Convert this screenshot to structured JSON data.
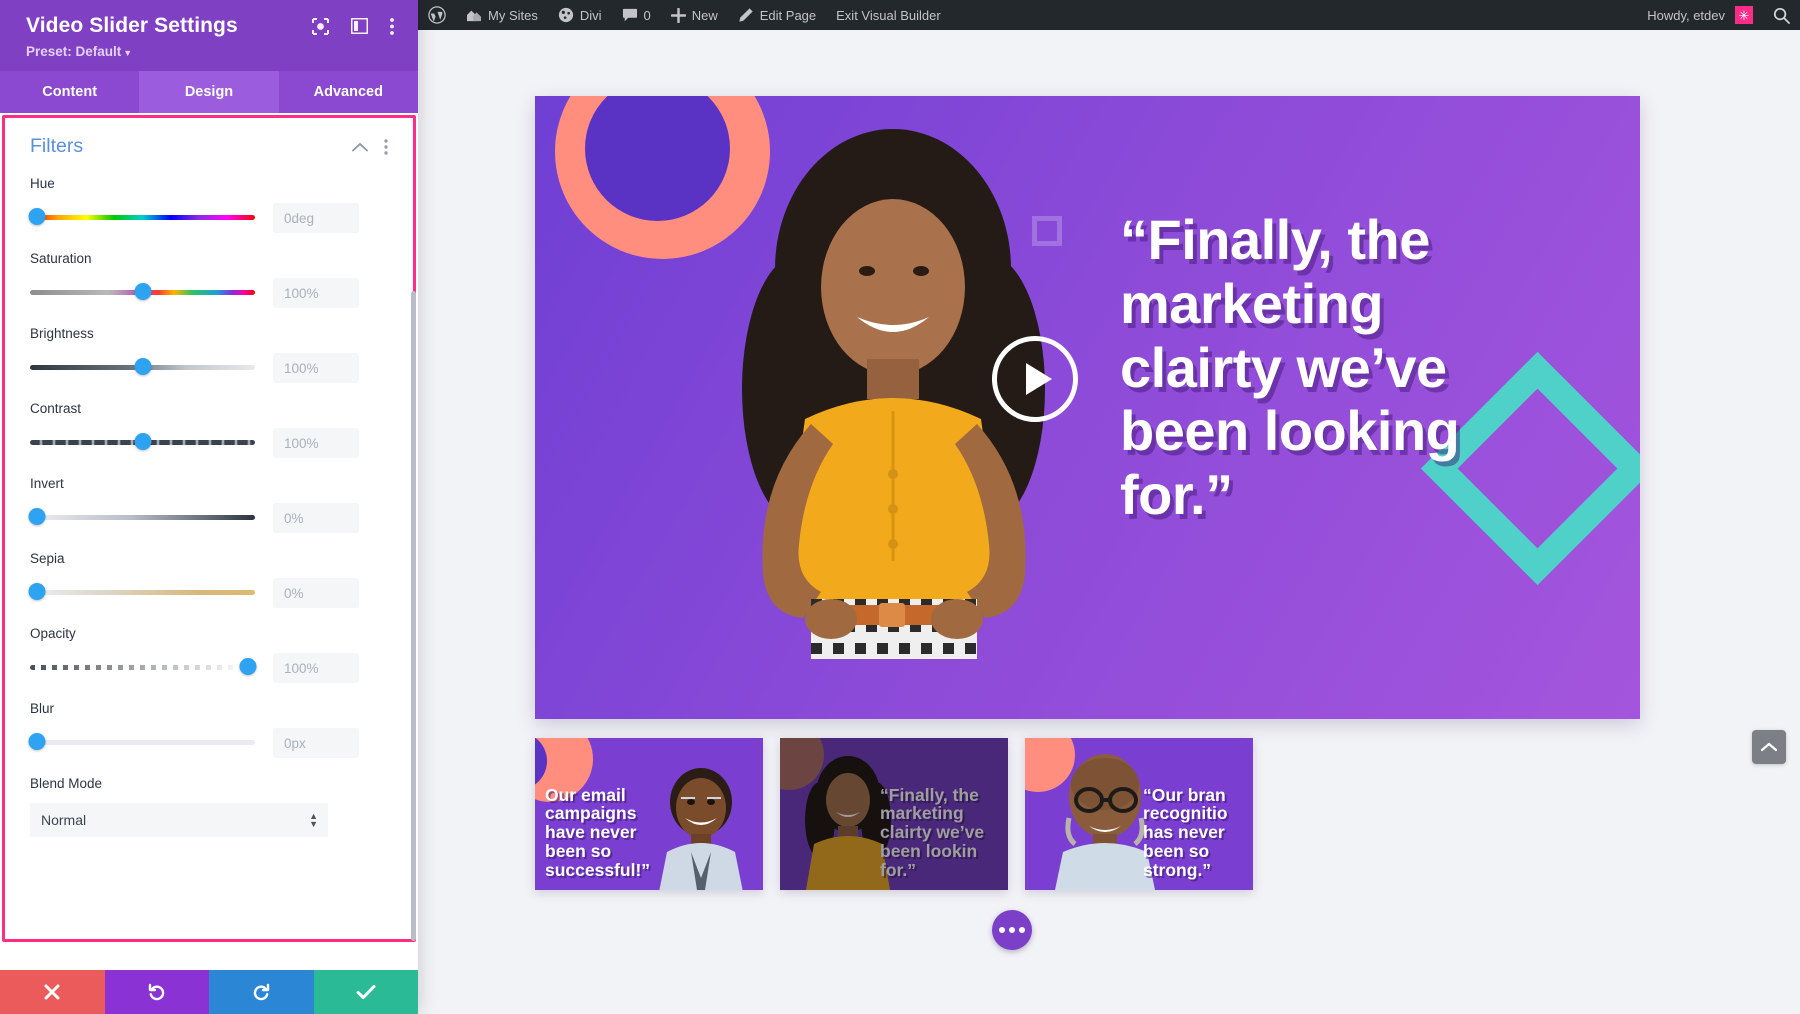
{
  "panel": {
    "title": "Video Slider Settings",
    "preset_label": "Preset: Default",
    "tabs": [
      {
        "label": "Content",
        "active": false
      },
      {
        "label": "Design",
        "active": true
      },
      {
        "label": "Advanced",
        "active": false
      }
    ],
    "section_title": "Filters",
    "fields": [
      {
        "label": "Hue",
        "value": "0deg",
        "knob_pct": 3,
        "track": "hue"
      },
      {
        "label": "Saturation",
        "value": "100%",
        "knob_pct": 50,
        "track": "saturation"
      },
      {
        "label": "Brightness",
        "value": "100%",
        "knob_pct": 50,
        "track": "brightness"
      },
      {
        "label": "Contrast",
        "value": "100%",
        "knob_pct": 50,
        "track": "contrast"
      },
      {
        "label": "Invert",
        "value": "0%",
        "knob_pct": 3,
        "track": "invert"
      },
      {
        "label": "Sepia",
        "value": "0%",
        "knob_pct": 3,
        "track": "sepia"
      },
      {
        "label": "Opacity",
        "value": "100%",
        "knob_pct": 97,
        "track": "opacity"
      },
      {
        "label": "Blur",
        "value": "0px",
        "knob_pct": 3,
        "track": "blur"
      }
    ],
    "blend_mode": {
      "label": "Blend Mode",
      "value": "Normal"
    },
    "footer": [
      {
        "name": "cancel",
        "icon": "close-icon"
      },
      {
        "name": "undo",
        "icon": "undo-icon"
      },
      {
        "name": "redo",
        "icon": "redo-icon"
      },
      {
        "name": "save",
        "icon": "check-icon"
      }
    ],
    "header_icons": [
      "target-icon",
      "layout-icon",
      "kebab-menu-icon"
    ],
    "section_icons": [
      "chevron-up-icon",
      "kebab-menu-icon"
    ],
    "colors": {
      "header_bg": "#7f40c3",
      "tab_active_bg": "#9b5ddd",
      "focus_outline": "#ff2d87",
      "section_title": "#5b91d6",
      "knob": "#2ea3f2"
    }
  },
  "adminbar": {
    "items": [
      {
        "icon": "wordpress-icon",
        "label": ""
      },
      {
        "icon": "sites-icon",
        "label": "My Sites"
      },
      {
        "icon": "divi-icon",
        "label": "Divi"
      },
      {
        "icon": "comment-icon",
        "label": "0"
      },
      {
        "icon": "plus-icon",
        "label": "New"
      },
      {
        "icon": "pencil-icon",
        "label": "Edit Page"
      },
      {
        "icon": "",
        "label": "Exit Visual Builder"
      }
    ],
    "howdy": "Howdy, etdev",
    "avatar_glyph": "✳",
    "search_icon": "search-icon"
  },
  "canvas": {
    "hero": {
      "quote": "“Finally, the marketing clairty we’ve been looking for.”",
      "play_button": "play-icon"
    },
    "thumbnails": [
      {
        "quote": "Our email campaigns have never been so successful!”",
        "active": true
      },
      {
        "quote": "“Finally, the marketing clairty we’ve been lookin for.”",
        "active": false
      },
      {
        "quote": "“Our bran recognitio has never been so strong.”",
        "active": false
      }
    ],
    "pager_icon": "ellipsis-icon",
    "scroll_top_icon": "chevron-up-icon"
  }
}
